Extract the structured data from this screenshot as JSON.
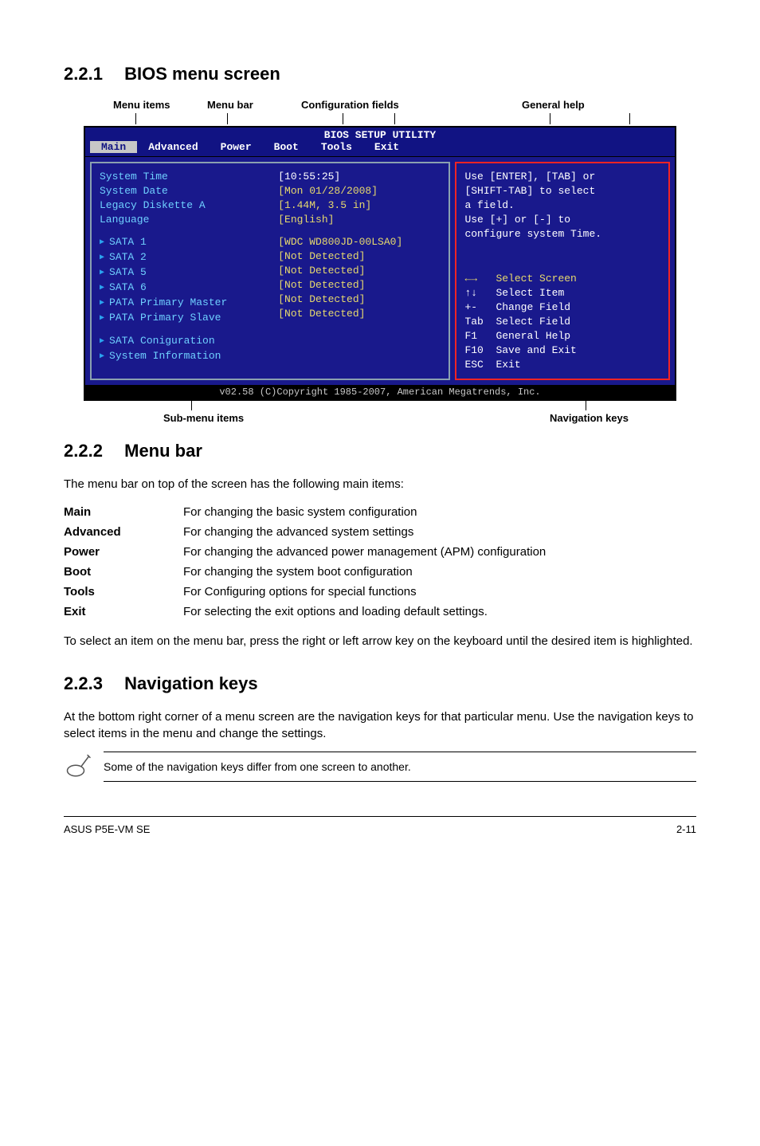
{
  "section_221": {
    "number": "2.2.1",
    "title": "BIOS menu screen"
  },
  "annot_top": {
    "menu_items": "Menu items",
    "menu_bar": "Menu bar",
    "config_fields": "Configuration fields",
    "general_help": "General help"
  },
  "bios": {
    "header": "BIOS SETUP UTILITY",
    "menubar": [
      "Main",
      "Advanced",
      "Power",
      "Boot",
      "Tools",
      "Exit"
    ],
    "left_items": {
      "system_time": "System Time",
      "system_date": "System Date",
      "legacy_disk": "Legacy Diskette A",
      "language": "Language",
      "sata1": "SATA 1",
      "sata2": "SATA 2",
      "sata5": "SATA 5",
      "sata6": "SATA 6",
      "pata_master": "PATA Primary Master",
      "pata_slave": "PATA Primary Slave",
      "sata_conf": "SATA Coniguration",
      "sysinfo": "System Information"
    },
    "mid_values": {
      "time": "[10:55:25]",
      "date": "[Mon 01/28/2008]",
      "disk": "[1.44M, 3.5 in]",
      "lang": "[English]",
      "sata1": "[WDC WD800JD-00LSA0]",
      "sata2": "[Not Detected]",
      "sata5": "[Not Detected]",
      "sata6": "[Not Detected]",
      "pata_m": "[Not Detected]",
      "pata_s": "[Not Detected]"
    },
    "help_top": [
      "Use [ENTER], [TAB] or",
      "[SHIFT-TAB] to select",
      "a field.",
      "",
      "Use [+] or [-] to",
      "configure system Time."
    ],
    "nav": {
      "arrows_lr": "←→   Select Screen",
      "arrows_ud": "↑↓   Select Item",
      "pm": "+-   Change Field",
      "tab": "Tab  Select Field",
      "f1": "F1   General Help",
      "f10": "F10  Save and Exit",
      "esc": "ESC  Exit"
    },
    "footer": "v02.58 (C)Copyright 1985-2007, American Megatrends, Inc."
  },
  "annot_bottom": {
    "sub_menu": "Sub-menu items",
    "nav_keys": "Navigation keys"
  },
  "section_222": {
    "number": "2.2.2",
    "title": "Menu bar",
    "intro": "The menu bar on top of the screen has the following main items:",
    "defs": [
      {
        "term": "Main",
        "desc": "For changing the basic system configuration"
      },
      {
        "term": "Advanced",
        "desc": "For changing the advanced system settings"
      },
      {
        "term": "Power",
        "desc": "For changing the advanced power management (APM) configuration"
      },
      {
        "term": "Boot",
        "desc": "For changing the system boot configuration"
      },
      {
        "term": "Tools",
        "desc": "For Configuring options for special functions"
      },
      {
        "term": "Exit",
        "desc": "For selecting the exit options and loading default settings."
      }
    ],
    "outro": "To select an item on the menu bar, press the right or left arrow key on the keyboard until the desired item is highlighted."
  },
  "section_223": {
    "number": "2.2.3",
    "title": "Navigation keys",
    "text": "At the bottom right corner of a menu screen are the navigation keys for that particular menu. Use the navigation keys to select items in the menu and change the settings.",
    "note": "Some of the navigation keys differ from one screen to another."
  },
  "footer": {
    "left": "ASUS P5E-VM SE",
    "right": "2-11"
  }
}
